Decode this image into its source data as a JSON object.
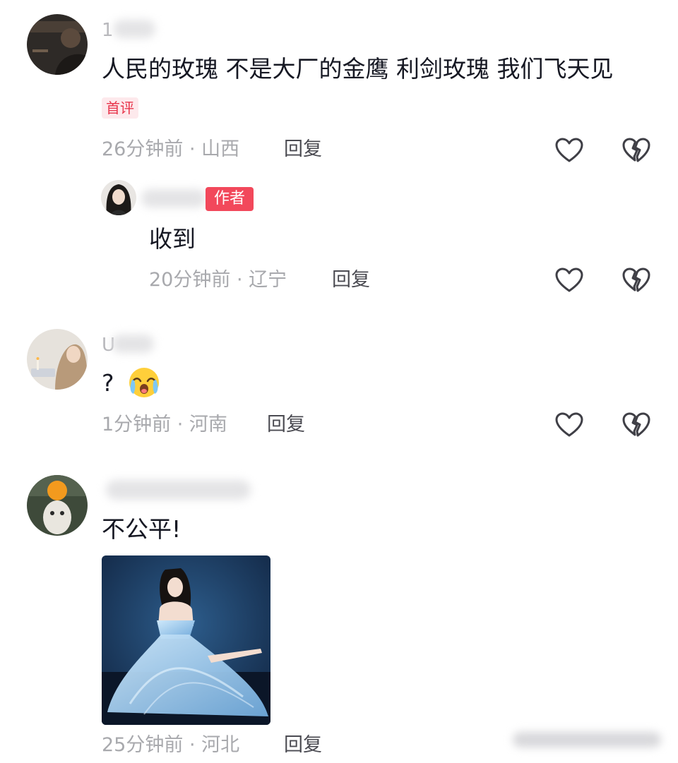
{
  "comments": [
    {
      "username": "1",
      "text": "人民的玫瑰 不是大厂的金鹰 利剑玫瑰 我们飞天见",
      "tag": "首评",
      "time_location": "26分钟前 · 山西",
      "reply_label": "回复",
      "reply": {
        "badge": "作者",
        "text": "收到",
        "time_location": "20分钟前 · 辽宁",
        "reply_label": "回复"
      }
    },
    {
      "username": "U",
      "text": "?",
      "emoji": "crying-laughing-emoji",
      "time_location": "1分钟前 · 河南",
      "reply_label": "回复"
    },
    {
      "username": "",
      "text": "不公平!",
      "image": "woman-in-blue-gown-photo",
      "time_location": "25分钟前 · 河北",
      "reply_label": "回复"
    }
  ],
  "icons": {
    "like": "heart-outline-icon",
    "dislike": "broken-heart-icon"
  },
  "colors": {
    "text": "#161823",
    "meta": "#a8a9ad",
    "reply": "#4b4b52",
    "tag_bg": "#fde9ec",
    "tag_text": "#e8354b",
    "author_badge": "#f2485b"
  }
}
